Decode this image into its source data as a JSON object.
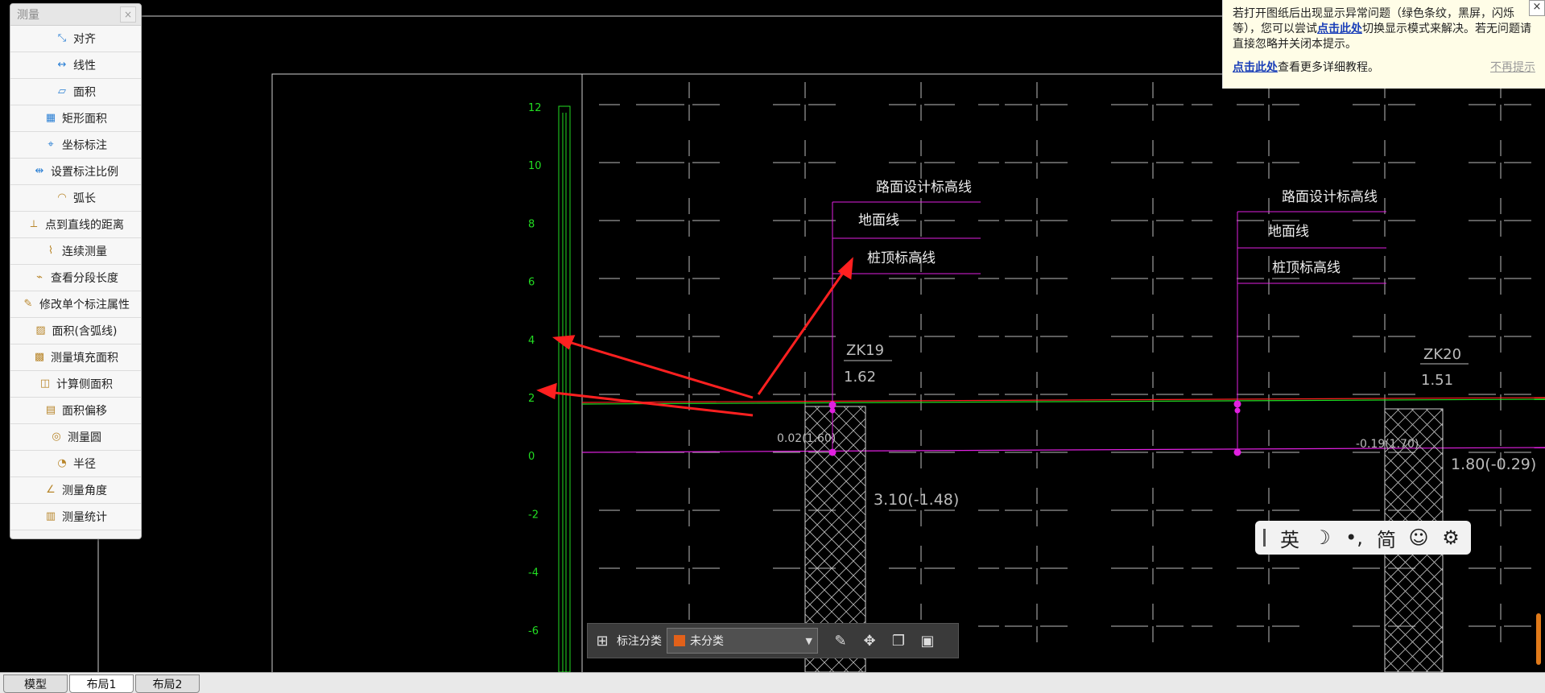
{
  "measure_panel": {
    "title": "测量",
    "close": "×",
    "tools": [
      {
        "label": "对齐",
        "icon": "align-measure-icon",
        "glyph": "⤡"
      },
      {
        "label": "线性",
        "icon": "linear-measure-icon",
        "glyph": "↔"
      },
      {
        "label": "面积",
        "icon": "area-icon",
        "glyph": "▱"
      },
      {
        "label": "矩形面积",
        "icon": "rect-area-icon",
        "glyph": "▦"
      },
      {
        "label": "坐标标注",
        "icon": "coordinate-icon",
        "glyph": "⌖"
      },
      {
        "label": "设置标注比例",
        "icon": "scale-icon",
        "glyph": "⇹"
      },
      {
        "label": "弧长",
        "icon": "arc-length-icon",
        "glyph": "◠"
      },
      {
        "label": "点到直线的距离",
        "icon": "point-line-distance-icon",
        "glyph": "⟂"
      },
      {
        "label": "连续测量",
        "icon": "continuous-measure-icon",
        "glyph": "⌇"
      },
      {
        "label": "查看分段长度",
        "icon": "segment-length-icon",
        "glyph": "⌁"
      },
      {
        "label": "修改单个标注属性",
        "icon": "edit-annotation-icon",
        "glyph": "✎"
      },
      {
        "label": "面积(含弧线)",
        "icon": "arc-area-icon",
        "glyph": "▨"
      },
      {
        "label": "测量填充面积",
        "icon": "fill-area-icon",
        "glyph": "▩"
      },
      {
        "label": "计算侧面积",
        "icon": "side-area-icon",
        "glyph": "◫"
      },
      {
        "label": "面积偏移",
        "icon": "area-offset-icon",
        "glyph": "▤"
      },
      {
        "label": "测量圆",
        "icon": "circle-measure-icon",
        "glyph": "◎"
      },
      {
        "label": "半径",
        "icon": "radius-icon",
        "glyph": "◔"
      },
      {
        "label": "测量角度",
        "icon": "angle-icon",
        "glyph": "∠"
      },
      {
        "label": "测量统计",
        "icon": "statistics-icon",
        "glyph": "▥"
      }
    ]
  },
  "notice": {
    "text_1": "若打开图纸后出现显示异常问题（绿色条纹，黑屏，闪烁等），您可以尝试",
    "link_1": "点击此处",
    "text_2": "切换显示模式来解决。若无问题请直接忽略并关闭本提示。",
    "link_2": "点击此处",
    "text_3": "查看更多详细教程。",
    "dismiss": "不再提示",
    "close": "×"
  },
  "drawing": {
    "y_axis_ticks": [
      "12",
      "10",
      "8",
      "6",
      "4",
      "2",
      "0",
      "-2",
      "-4",
      "-6"
    ],
    "legend_left": {
      "road_line": "路面设计标高线",
      "ground_line": "地面线",
      "pile_top": "桩顶标高线"
    },
    "legend_right": {
      "road_line": "路面设计标高线",
      "ground_line": "地面线",
      "pile_top": "桩顶标高线"
    },
    "borehole_1": {
      "name": "ZK19",
      "value": "1.62",
      "ground_label": "0.02(1.60)",
      "bottom_label": "3.10(-1.48)"
    },
    "borehole_2": {
      "name": "ZK20",
      "value": "1.51",
      "ground_label": "-0.19(1.70)",
      "bottom_label": "1.80(-0.29)"
    }
  },
  "ime": {
    "items": [
      "英",
      "☽",
      "•,",
      "简",
      "☺",
      "⚙"
    ]
  },
  "annotation_bar": {
    "category_label": "标注分类",
    "selected": "未分类",
    "swatch_color": "#e2611a"
  },
  "tabs": [
    "模型",
    "布局1",
    "布局2"
  ],
  "active_tab": "布局1",
  "colors": {
    "grid": "#bdbdbd",
    "axis_green": "#22dd22",
    "magenta": "#e020e0",
    "red_arrow": "#ff2020"
  }
}
